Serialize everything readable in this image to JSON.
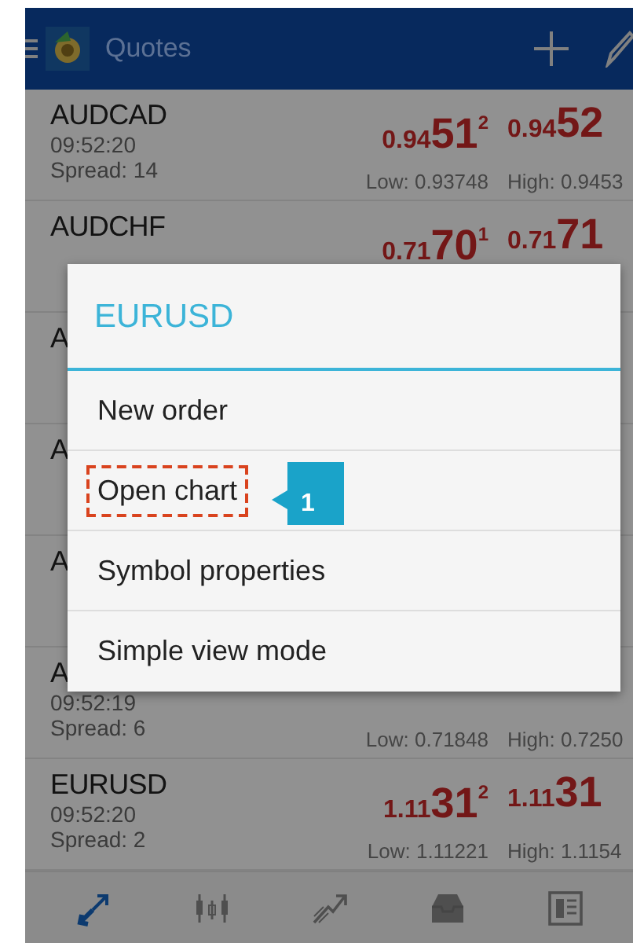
{
  "header": {
    "title": "Quotes"
  },
  "quotes": [
    {
      "symbol": "AUDCAD",
      "time": "09:52:20",
      "spread": "Spread: 14",
      "bid": {
        "small": "0.94",
        "big": "51",
        "sup": "2"
      },
      "ask": {
        "small": "0.94",
        "big": "52"
      },
      "low": "Low: 0.93748",
      "high": "High: 0.9453"
    },
    {
      "symbol": "AUDCHF",
      "bid": {
        "small": "0.71",
        "big": "70",
        "sup": "1"
      },
      "ask": {
        "small": "0.71",
        "big": "71"
      }
    },
    {
      "symbol": "A"
    },
    {
      "symbol": "A"
    },
    {
      "symbol": "A"
    },
    {
      "symbol": "A",
      "time": "09:52:19",
      "spread": "Spread: 6",
      "low": "Low: 0.71848",
      "high": "High: 0.7250"
    },
    {
      "symbol": "EURUSD",
      "time": "09:52:20",
      "spread": "Spread: 2",
      "bid": {
        "small": "1.11",
        "big": "31",
        "sup": "2"
      },
      "ask": {
        "small": "1.11",
        "big": "31"
      },
      "low": "Low: 1.11221",
      "high": "High: 1.1154"
    }
  ],
  "dialog": {
    "title": "EURUSD",
    "items": [
      {
        "label": "New order",
        "highlighted": false
      },
      {
        "label": "Open chart",
        "highlighted": true,
        "callout": "1"
      },
      {
        "label": "Symbol properties",
        "highlighted": false
      },
      {
        "label": "Simple view mode",
        "highlighted": false
      }
    ]
  },
  "tabs": [
    {
      "kind": "quotes",
      "selected": true
    },
    {
      "kind": "chart",
      "selected": false
    },
    {
      "kind": "trade",
      "selected": false
    },
    {
      "kind": "history",
      "selected": false
    },
    {
      "kind": "news",
      "selected": false
    }
  ]
}
